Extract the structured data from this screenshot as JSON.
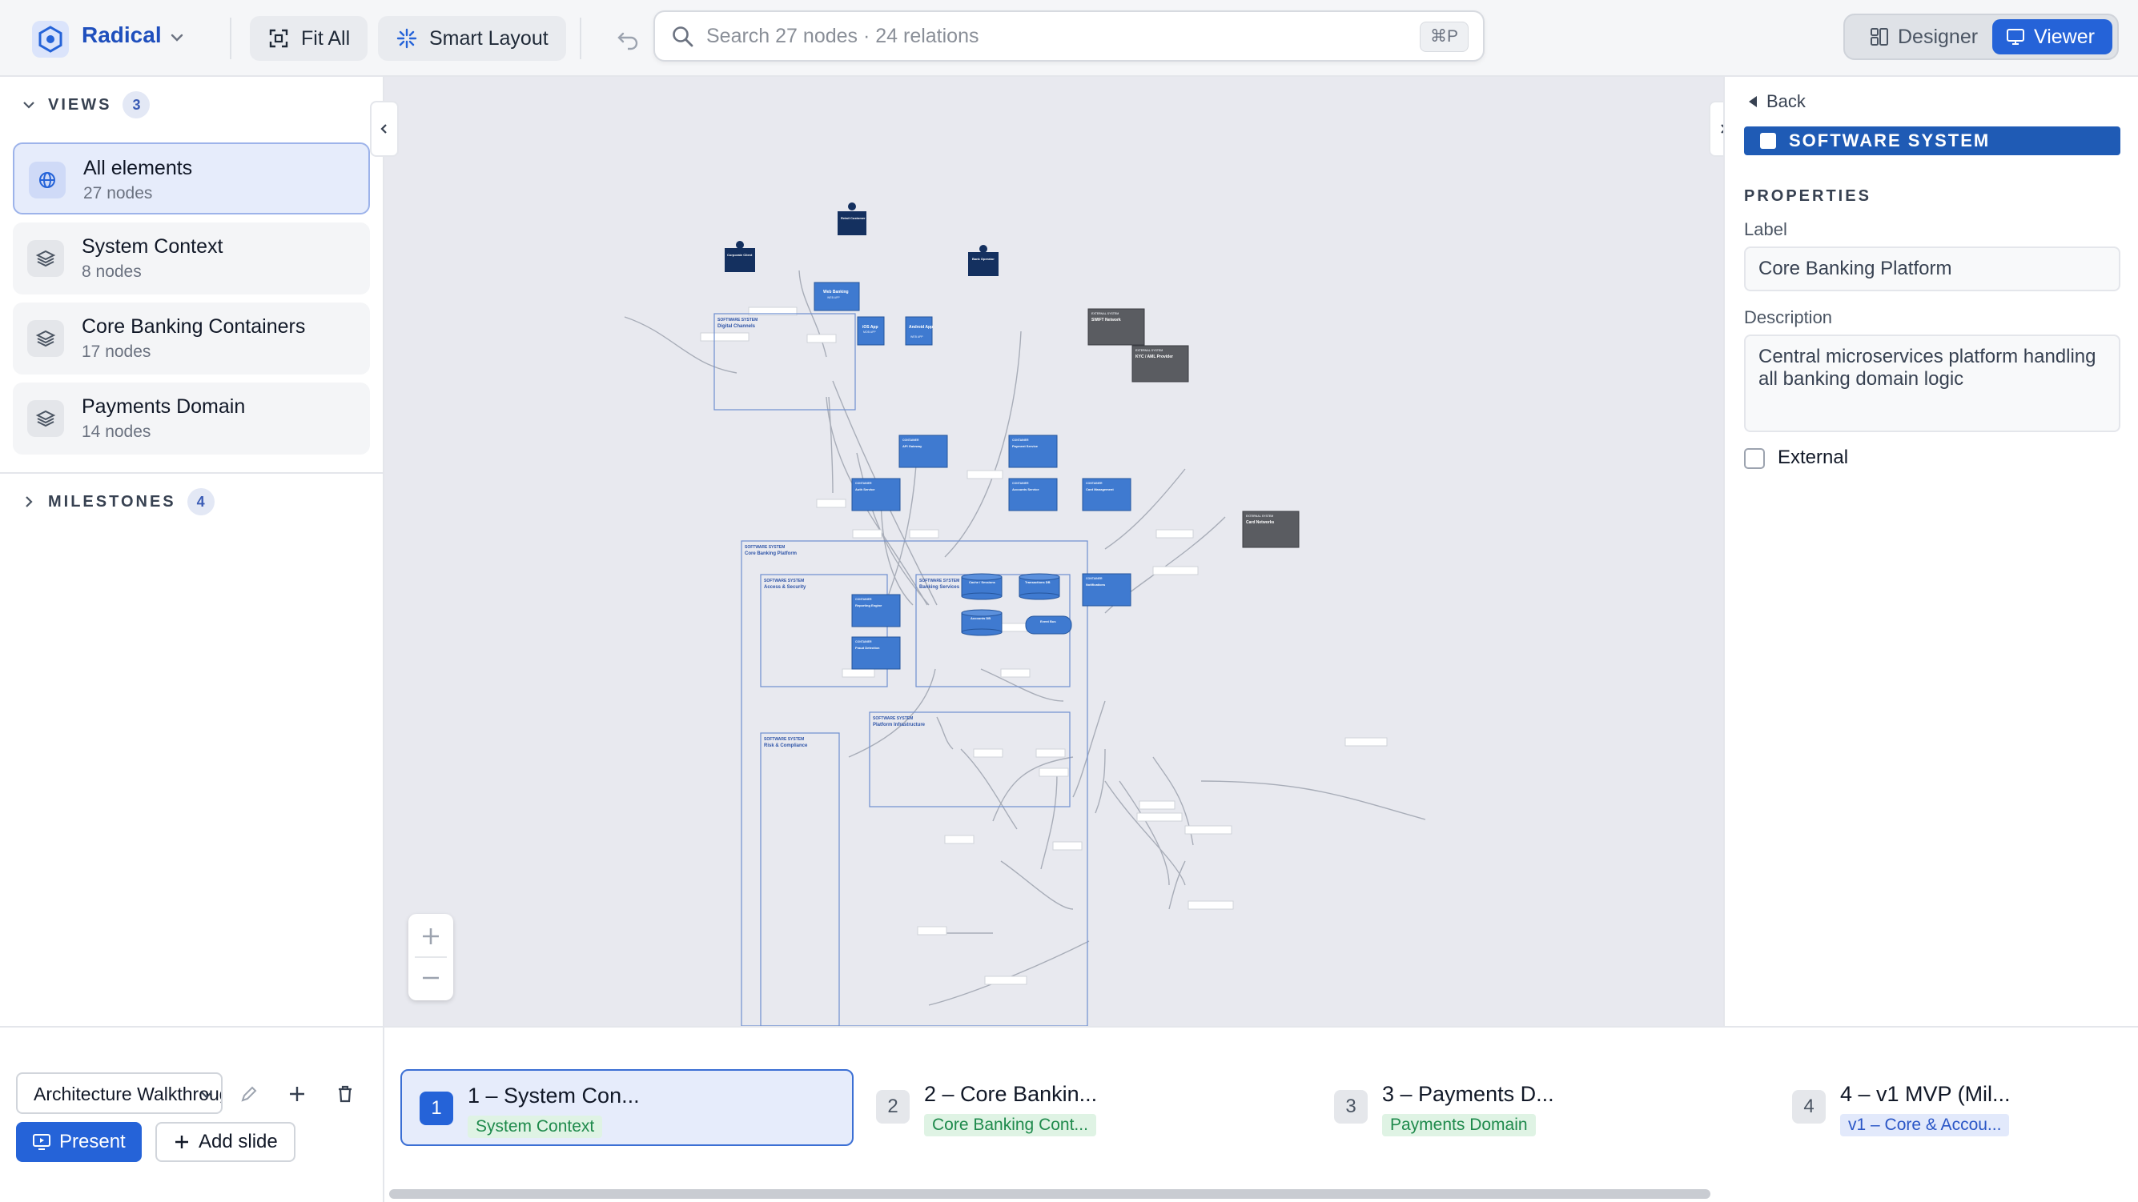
{
  "app": {
    "name": "Radical",
    "accent": "#2563d8"
  },
  "toolbar": {
    "fit_all": "Fit All",
    "smart_layout": "Smart Layout"
  },
  "search": {
    "placeholder": "Search 27 nodes · 24 relations",
    "shortcut": "⌘P"
  },
  "mode": {
    "designer": "Designer",
    "viewer": "Viewer",
    "active": "viewer"
  },
  "sidebar": {
    "views_label": "VIEWS",
    "views_count": "3",
    "items": [
      {
        "title": "All elements",
        "sub": "27 nodes",
        "icon": "globe-icon",
        "active": true
      },
      {
        "title": "System Context",
        "sub": "8 nodes",
        "icon": "layers-icon"
      },
      {
        "title": "Core Banking Containers",
        "sub": "17 nodes",
        "icon": "layers-icon"
      },
      {
        "title": "Payments Domain",
        "sub": "14 nodes",
        "icon": "layers-icon"
      }
    ],
    "milestones_label": "MILESTONES",
    "milestones_count": "4"
  },
  "inspector": {
    "back": "Back",
    "type": "SOFTWARE SYSTEM",
    "properties": "PROPERTIES",
    "label_label": "Label",
    "label_value": "Core Banking Platform",
    "description_label": "Description",
    "description_value": "Central microservices platform handling all banking domain logic",
    "external_label": "External"
  },
  "presentation": {
    "name": "Architecture Walkthrough",
    "present": "Present",
    "add_slide": "Add slide"
  },
  "slides": [
    {
      "num": "1",
      "title": "1 – System Con...",
      "tag": "System Context",
      "tag_color": "#1f8a4c",
      "tag_bg": "#dff3e4",
      "active": true
    },
    {
      "num": "2",
      "title": "2 – Core Bankin...",
      "tag": "Core Banking Cont...",
      "tag_color": "#1f8a4c",
      "tag_bg": "#dff3e4"
    },
    {
      "num": "3",
      "title": "3 – Payments D...",
      "tag": "Payments Domain",
      "tag_color": "#1f8a4c",
      "tag_bg": "#dff3e4"
    },
    {
      "num": "4",
      "title": "4 – v1 MVP (Mil...",
      "tag": "v1 – Core & Accou...",
      "tag_color": "#2a56c6",
      "tag_bg": "#e2e9fb"
    }
  ],
  "diagram": {
    "persons": [
      {
        "name": "Retail Customer",
        "kind": "PERSON"
      },
      {
        "name": "Corporate Client",
        "kind": "PERSON"
      },
      {
        "name": "Bank Operator",
        "kind": "PERSON"
      }
    ],
    "boundaries": {
      "digital": "Digital Channels",
      "core": "Core Banking Platform",
      "access": "Access & Security",
      "banking": "Banking Services",
      "infra": "Platform Infrastructure",
      "risk": "Risk & Compliance",
      "kind": "SOFTWARE SYSTEM"
    },
    "containers": {
      "web": "Web Banking",
      "web_kind": "WEB APP",
      "ios": "iOS App",
      "ios_kind": "MOB APP",
      "android": "Android App",
      "android_kind": "WEB APP",
      "gateway": "API Gateway",
      "auth": "Auth Service",
      "payment": "Payment Service",
      "accounts": "Accounts Service",
      "card_mgmt": "Card Management",
      "reporting": "Reporting Engine",
      "fraud": "Fraud Detection",
      "notifications": "Notifications",
      "cache": "Cache / Sessions",
      "tx_db": "Transactions DB",
      "accounts_db": "Accounts DB",
      "event_bus": "Event Bus",
      "kind": "CONTAINER"
    },
    "external": {
      "swift": "SWIFT Network",
      "kyc": "KYC / AML Provider",
      "cards": "Card Networks",
      "kind": "EXTERNAL SYSTEM"
    }
  }
}
